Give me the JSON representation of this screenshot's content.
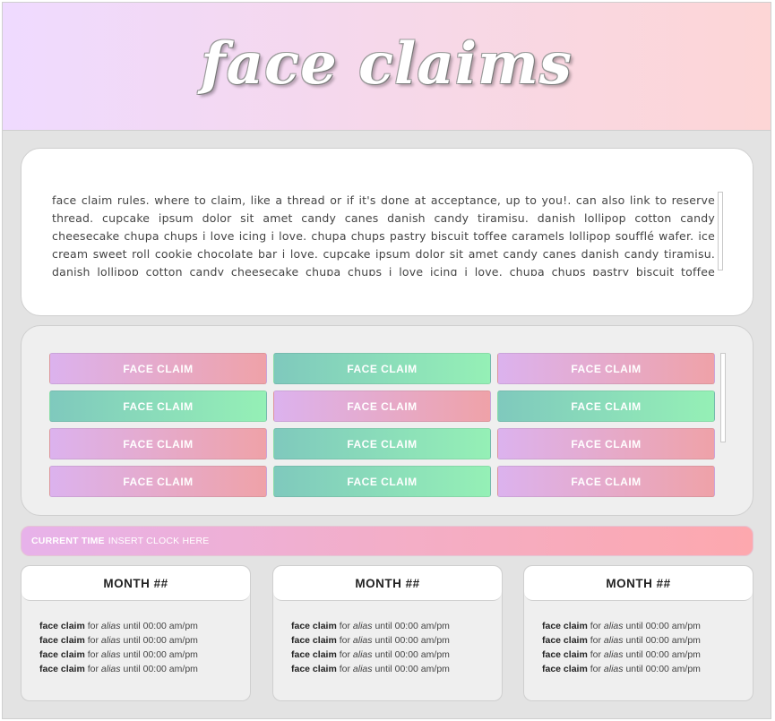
{
  "header": {
    "title": "face claims"
  },
  "rules": {
    "text": "face claim rules. where to claim, like a thread or if it's done at acceptance, up to you!. can also link to reserve thread. cupcake ipsum dolor sit amet candy canes danish candy tiramisu. danish lollipop cotton candy cheesecake chupa chups i love icing i love. chupa chups pastry biscuit toffee caramels lollipop soufflé wafer. ice cream sweet roll cookie chocolate bar i love. cupcake ipsum dolor sit amet candy canes danish candy tiramisu. danish lollipop cotton candy cheesecake chupa chups i love icing i love. chupa chups pastry biscuit toffee caramels lollipop soufflé wafer."
  },
  "face_claims": {
    "items": [
      {
        "label": "FACE CLAIM",
        "style": "pink"
      },
      {
        "label": "FACE CLAIM",
        "style": "green"
      },
      {
        "label": "FACE CLAIM",
        "style": "pink"
      },
      {
        "label": "FACE CLAIM",
        "style": "green"
      },
      {
        "label": "FACE CLAIM",
        "style": "pink"
      },
      {
        "label": "FACE CLAIM",
        "style": "green"
      },
      {
        "label": "FACE CLAIM",
        "style": "pink"
      },
      {
        "label": "FACE CLAIM",
        "style": "green"
      },
      {
        "label": "FACE CLAIM",
        "style": "pink"
      },
      {
        "label": "FACE CLAIM",
        "style": "pink"
      },
      {
        "label": "FACE CLAIM",
        "style": "green"
      },
      {
        "label": "FACE CLAIM",
        "style": "pink"
      }
    ]
  },
  "clock": {
    "label": "CURRENT TIME",
    "value": "INSERT CLOCK HERE"
  },
  "months": [
    {
      "title": "MONTH ##",
      "entries": [
        {
          "name": "face claim",
          "for": "for",
          "alias": "alias",
          "until": "until 00:00 am/pm"
        },
        {
          "name": "face claim",
          "for": "for",
          "alias": "alias",
          "until": "until 00:00 am/pm"
        },
        {
          "name": "face claim",
          "for": "for",
          "alias": "alias",
          "until": "until 00:00 am/pm"
        },
        {
          "name": "face claim",
          "for": "for",
          "alias": "alias",
          "until": "until 00:00 am/pm"
        }
      ]
    },
    {
      "title": "MONTH ##",
      "entries": [
        {
          "name": "face claim",
          "for": "for",
          "alias": "alias",
          "until": "until 00:00 am/pm"
        },
        {
          "name": "face claim",
          "for": "for",
          "alias": "alias",
          "until": "until 00:00 am/pm"
        },
        {
          "name": "face claim",
          "for": "for",
          "alias": "alias",
          "until": "until 00:00 am/pm"
        },
        {
          "name": "face claim",
          "for": "for",
          "alias": "alias",
          "until": "until 00:00 am/pm"
        }
      ]
    },
    {
      "title": "MONTH ##",
      "entries": [
        {
          "name": "face claim",
          "for": "for",
          "alias": "alias",
          "until": "until 00:00 am/pm"
        },
        {
          "name": "face claim",
          "for": "for",
          "alias": "alias",
          "until": "until 00:00 am/pm"
        },
        {
          "name": "face claim",
          "for": "for",
          "alias": "alias",
          "until": "until 00:00 am/pm"
        },
        {
          "name": "face claim",
          "for": "for",
          "alias": "alias",
          "until": "until 00:00 am/pm"
        }
      ]
    }
  ],
  "colors": {
    "header_gradient": [
      "#efdaff",
      "#fdd6d6"
    ],
    "pink_gradient": [
      "#dcb2ee",
      "#efa2a8"
    ],
    "green_gradient": [
      "#7fc9bd",
      "#95f0b6"
    ],
    "clock_gradient": [
      "#e7b2ea",
      "#fda8ae"
    ]
  }
}
